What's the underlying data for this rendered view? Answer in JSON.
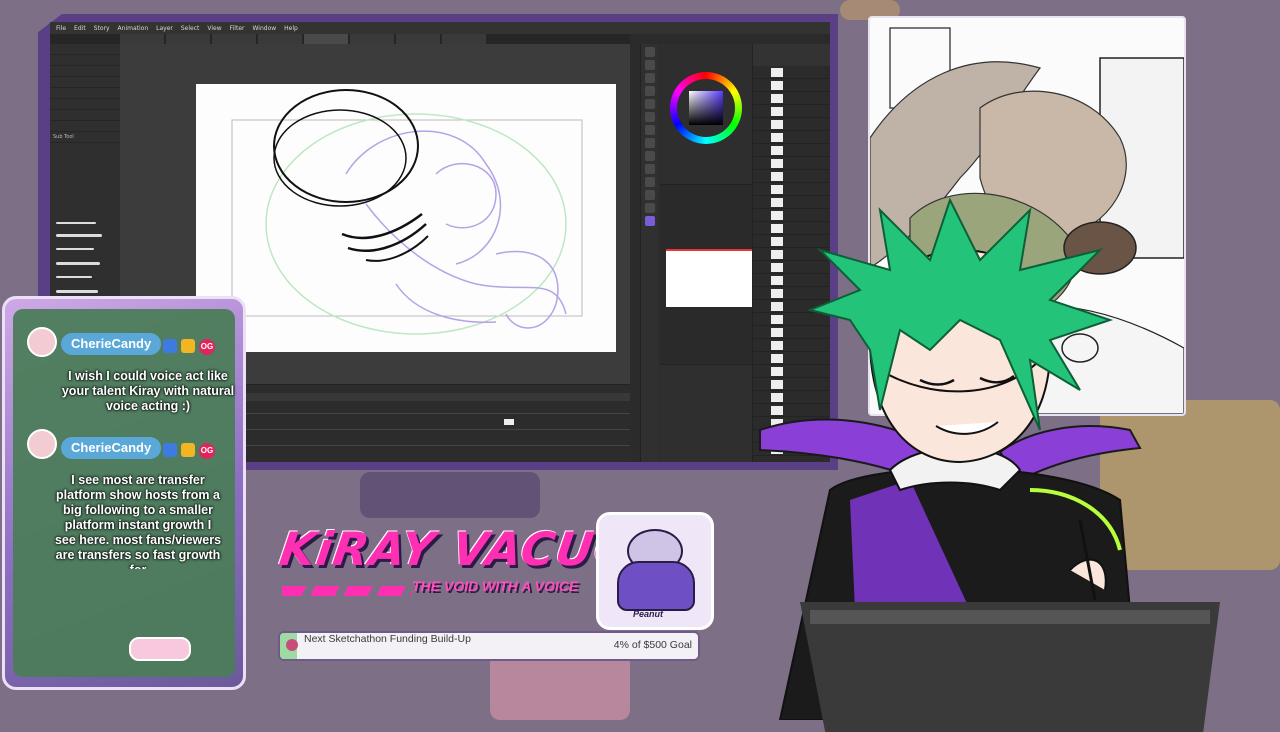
{
  "app": {
    "menu": [
      "File",
      "Edit",
      "Story",
      "Animation",
      "Layer",
      "Select",
      "View",
      "Filter",
      "Window",
      "Help"
    ],
    "tabs": [
      "",
      "",
      "",
      "",
      "",
      "",
      "",
      "",
      "",
      ""
    ],
    "brush_panel_label": "Sub Tool"
  },
  "chat": {
    "messages": [
      {
        "user": "CherieCandy",
        "badge": "OG",
        "text": "I wish I could voice act like your talent Kiray with natural voice acting :)"
      },
      {
        "user": "CherieCandy",
        "badge": "OG",
        "text": "I see most are transfer platform show hosts from a big following to a smaller platform instant growth I see here. most fans/viewers are transfers so fast growth for"
      }
    ]
  },
  "branding": {
    "logo": "KiRAY VACUO",
    "tagline": "THE VOID WITH A VOICE",
    "mascot_label": "Peanut"
  },
  "goal": {
    "title": "Next Sketchathon Funding Build-Up",
    "amount": "4% of $500 Goal",
    "progress": 0.04
  },
  "colors": {
    "accent": "#ff2fb3",
    "frame": "#5b3f86",
    "chat_name": "#5aa8d8",
    "goal_fill": "#9edba4",
    "hair": "#23c47a"
  }
}
